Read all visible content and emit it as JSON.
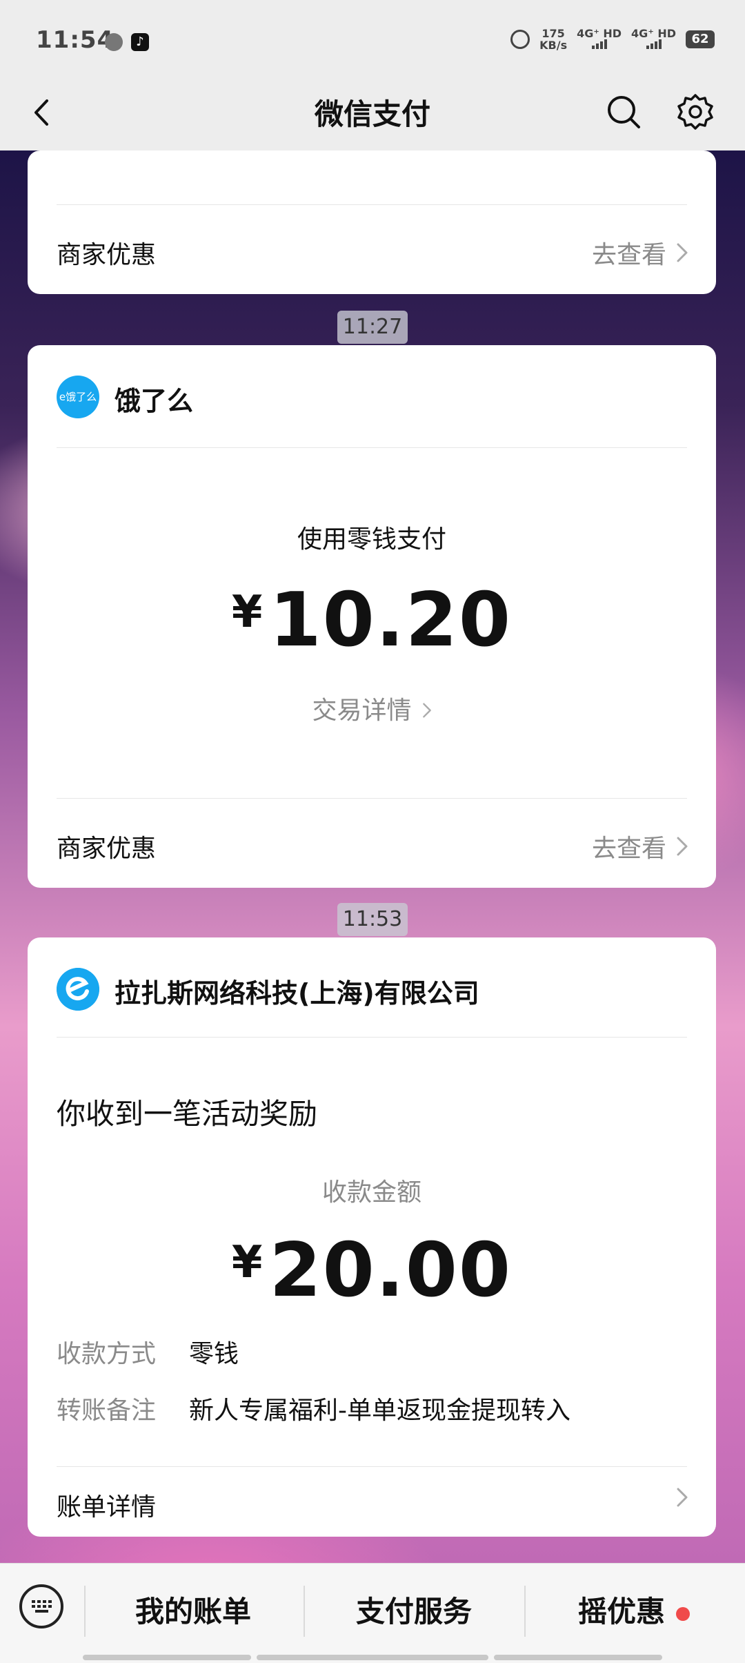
{
  "status_bar": {
    "time": "11:54",
    "net_speed_value": "175",
    "net_speed_unit": "KB/s",
    "signal1_label": "4G⁺ HD",
    "signal2_label": "4G⁺ HD",
    "battery": "62"
  },
  "nav": {
    "title": "微信支付"
  },
  "card1": {
    "promo_label": "商家优惠",
    "promo_action": "去查看"
  },
  "msg2": {
    "time": "11:27",
    "merchant_name": "饿了么",
    "merchant_logo_text": "e饿了么",
    "pay_method": "使用零钱支付",
    "currency": "¥",
    "amount": "10.20",
    "details_link": "交易详情",
    "promo_label": "商家优惠",
    "promo_action": "去查看"
  },
  "msg3": {
    "time": "11:53",
    "merchant_name": "拉扎斯网络科技(上海)有限公司",
    "headline": "你收到一笔活动奖励",
    "amount_label": "收款金额",
    "currency": "¥",
    "amount": "20.00",
    "fields": [
      {
        "key": "收款方式",
        "value": "零钱"
      },
      {
        "key": "转账备注",
        "value": "新人专属福利-单单返现金提现转入"
      }
    ],
    "bill_details": "账单详情"
  },
  "bottom_bar": {
    "items": [
      "我的账单",
      "支付服务",
      "摇优惠"
    ]
  },
  "colors": {
    "accent_blue": "#17a7f0",
    "notice_red": "#f04a4a"
  }
}
